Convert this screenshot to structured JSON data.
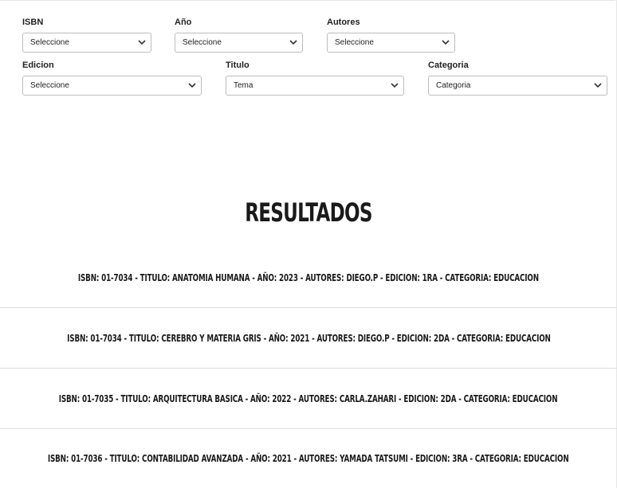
{
  "filters": {
    "isbn": {
      "label": "ISBN",
      "value": "Seleccione"
    },
    "anio": {
      "label": "Año",
      "value": "Seleccione"
    },
    "autores": {
      "label": "Autores",
      "value": "Seleccione"
    },
    "edicion": {
      "label": "Edicion",
      "value": "Seleccione"
    },
    "titulo": {
      "label": "Titulo",
      "value": "Tema"
    },
    "categoria": {
      "label": "Categoria",
      "value": "Categoria"
    }
  },
  "results": {
    "title": "RESULTADOS",
    "items": [
      "ISBN: 01-7034 - TITULO: ANATOMIA HUMANA - AÑO: 2023 - AUTORES: DIEGO.P - EDICION: 1RA - CATEGORIA: EDUCACION",
      "ISBN: 01-7034 - TITULO: CEREBRO Y MATERIA GRIS - AÑO: 2021 - AUTORES: DIEGO.P - EDICION: 2DA - CATEGORIA: EDUCACION",
      "ISBN: 01-7035 - TITULO: ARQUITECTURA BASICA - AÑO: 2022 - AUTORES: CARLA.ZAHARI - EDICION: 2DA - CATEGORIA: EDUCACION",
      "ISBN: 01-7036 - TITULO: CONTABILIDAD AVANZADA - AÑO: 2021 - AUTORES: YAMADA TATSUMI - EDICION: 3RA - CATEGORIA: EDUCACION"
    ]
  }
}
